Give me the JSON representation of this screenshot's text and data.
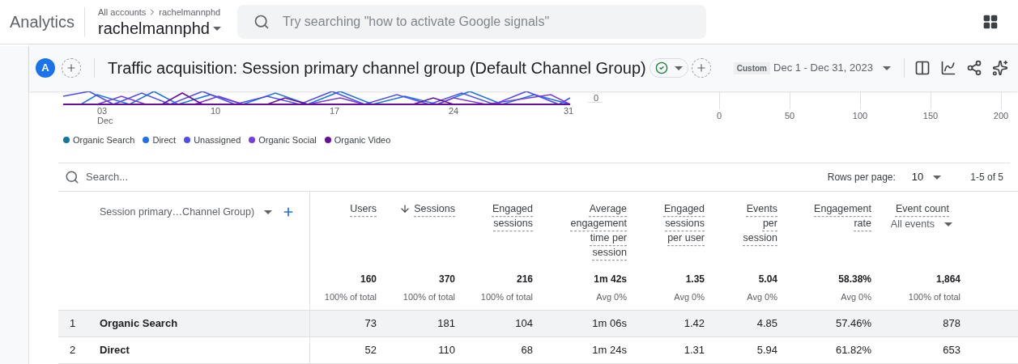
{
  "header": {
    "product": "Analytics",
    "breadcrumb": [
      "All accounts",
      "rachelmannphd"
    ],
    "account": "rachelmannphd",
    "search": {
      "placeholder": "Try searching \"how to activate Google signals\""
    }
  },
  "report": {
    "avatar": "A",
    "title": "Traffic acquisition: Session primary channel group (Default Channel Group)",
    "date_badge": "Custom",
    "date_range": "Dec 1 - Dec 31, 2023"
  },
  "line_chart": {
    "y_tick": "0",
    "x_ticks": [
      {
        "label": "03",
        "sub": "Dec"
      },
      {
        "label": "10"
      },
      {
        "label": "17"
      },
      {
        "label": "24"
      },
      {
        "label": "31"
      }
    ],
    "legend": [
      {
        "label": "Organic Search",
        "color": "#12769e"
      },
      {
        "label": "Direct",
        "color": "#1a73e8"
      },
      {
        "label": "Unassigned",
        "color": "#4e4ef5"
      },
      {
        "label": "Organic Social",
        "color": "#7a3be0"
      },
      {
        "label": "Organic Video",
        "color": "#6a0e9c"
      }
    ]
  },
  "bar_chart": {
    "x_ticks": [
      "0",
      "50",
      "100",
      "150",
      "200"
    ]
  },
  "table": {
    "search": {
      "placeholder": "Search..."
    },
    "rows_per_page_label": "Rows per page:",
    "rows_per_page": "10",
    "range": "1-5 of 5",
    "dimension": "Session primary…Channel Group)",
    "columns": [
      {
        "lines": [
          "Users"
        ],
        "sorted": false,
        "total": "160",
        "note": "100% of total"
      },
      {
        "lines": [
          "Sessions"
        ],
        "sorted": true,
        "total": "370",
        "note": "100% of total"
      },
      {
        "lines": [
          "Engaged",
          "sessions"
        ],
        "sorted": false,
        "total": "216",
        "note": "100% of total"
      },
      {
        "lines": [
          "Average",
          "engagement",
          "time per",
          "session"
        ],
        "sorted": false,
        "total": "1m 42s",
        "note": "Avg 0%"
      },
      {
        "lines": [
          "Engaged",
          "sessions",
          "per user"
        ],
        "sorted": false,
        "total": "1.35",
        "note": "Avg 0%"
      },
      {
        "lines": [
          "Events",
          "per",
          "session"
        ],
        "sorted": false,
        "total": "5.04",
        "note": "Avg 0%"
      },
      {
        "lines": [
          "Engagement",
          "rate"
        ],
        "sorted": false,
        "total": "58.38%",
        "note": "Avg 0%"
      },
      {
        "lines": [
          "Event count"
        ],
        "sorted": false,
        "filter": "All events",
        "total": "1,864",
        "note": "100% of total"
      }
    ],
    "rows": [
      {
        "index": "1",
        "name": "Organic Search",
        "highlighted": true,
        "values": [
          "73",
          "181",
          "104",
          "1m 06s",
          "1.42",
          "4.85",
          "57.46%",
          "878"
        ]
      },
      {
        "index": "2",
        "name": "Direct",
        "highlighted": false,
        "values": [
          "52",
          "110",
          "68",
          "1m 24s",
          "1.31",
          "5.94",
          "61.82%",
          "653"
        ]
      }
    ]
  }
}
